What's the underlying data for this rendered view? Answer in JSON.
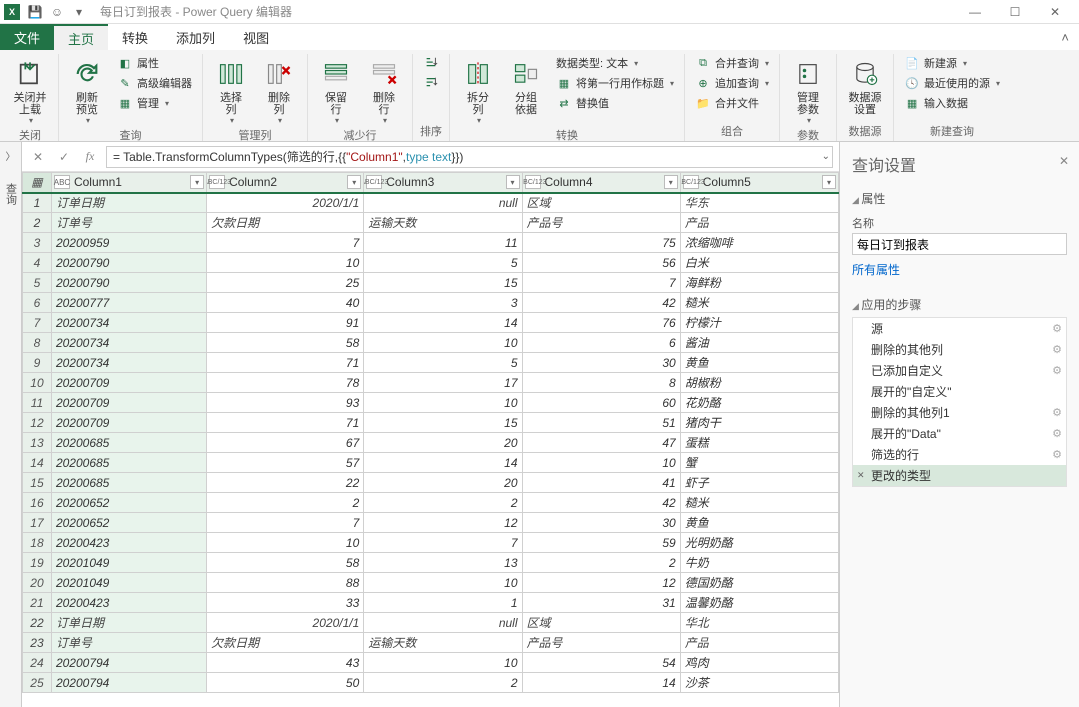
{
  "window": {
    "title": "每日订到报表 - Power Query 编辑器",
    "app_abbrev": "X"
  },
  "ribbon": {
    "tabs": {
      "file": "文件",
      "home": "主页",
      "transform": "转换",
      "addcol": "添加列",
      "view": "视图"
    },
    "close_upload": "关闭并\n上载",
    "refresh_preview": "刷新\n预览",
    "properties": "属性",
    "adv_editor": "高级编辑器",
    "manage": "管理",
    "choose_cols": "选择\n列",
    "remove_cols": "删除\n列",
    "keep_rows": "保留\n行",
    "remove_rows": "删除\n行",
    "sort_asc": "",
    "sort_desc": "",
    "split_col": "拆分\n列",
    "group_by": "分组\n依据",
    "datatype": "数据类型: 文本",
    "first_row_header": "将第一行用作标题",
    "replace_values": "替换值",
    "merge_q": "合并查询",
    "append_q": "追加查询",
    "merge_files": "合并文件",
    "manage_params": "管理\n参数",
    "datasource_settings": "数据源\n设置",
    "new_source": "新建源",
    "recent_sources": "最近使用的源",
    "enter_data": "输入数据",
    "groups": {
      "close": "关闭",
      "query": "查询",
      "manage_cols": "管理列",
      "reduce_rows": "减少行",
      "sort": "排序",
      "transform": "转换",
      "combine": "组合",
      "params": "参数",
      "datasources": "数据源",
      "new_query": "新建查询"
    }
  },
  "formula": "= Table.TransformColumnTypes(筛选的行,{{\"Column1\", type text}})",
  "formula_parts": {
    "p1": "= Table.TransformColumnTypes(筛选的行,{{",
    "p2": "\"Column1\"",
    "p3": ", ",
    "p4": "type text",
    "p5": "}})"
  },
  "left_label": "查询",
  "columns": [
    {
      "name": "Column1",
      "type": "ABC"
    },
    {
      "name": "Column2",
      "type": "ABC/123"
    },
    {
      "name": "Column3",
      "type": "ABC/123"
    },
    {
      "name": "Column4",
      "type": "ABC/123"
    },
    {
      "name": "Column5",
      "type": "ABC/123"
    }
  ],
  "rows": [
    {
      "n": 1,
      "c1": "订单日期",
      "c2": "2020/1/1",
      "c3": "null",
      "c4": "区域",
      "c5": "华东",
      "section": true
    },
    {
      "n": 2,
      "c1": "订单号",
      "c2": "欠款日期",
      "c3": "运输天数",
      "c4": "产品号",
      "c5": "产品",
      "section": true,
      "c2txt": true,
      "c3txt": true,
      "c4txt": true
    },
    {
      "n": 3,
      "c1": "20200959",
      "c2": "7",
      "c3": "11",
      "c4": "75",
      "c5": "浓缩咖啡"
    },
    {
      "n": 4,
      "c1": "20200790",
      "c2": "10",
      "c3": "5",
      "c4": "56",
      "c5": "白米"
    },
    {
      "n": 5,
      "c1": "20200790",
      "c2": "25",
      "c3": "15",
      "c4": "7",
      "c5": "海鲜粉"
    },
    {
      "n": 6,
      "c1": "20200777",
      "c2": "40",
      "c3": "3",
      "c4": "42",
      "c5": "糙米"
    },
    {
      "n": 7,
      "c1": "20200734",
      "c2": "91",
      "c3": "14",
      "c4": "76",
      "c5": "柠檬汁"
    },
    {
      "n": 8,
      "c1": "20200734",
      "c2": "58",
      "c3": "10",
      "c4": "6",
      "c5": "酱油"
    },
    {
      "n": 9,
      "c1": "20200734",
      "c2": "71",
      "c3": "5",
      "c4": "30",
      "c5": "黄鱼"
    },
    {
      "n": 10,
      "c1": "20200709",
      "c2": "78",
      "c3": "17",
      "c4": "8",
      "c5": "胡椒粉"
    },
    {
      "n": 11,
      "c1": "20200709",
      "c2": "93",
      "c3": "10",
      "c4": "60",
      "c5": "花奶酪"
    },
    {
      "n": 12,
      "c1": "20200709",
      "c2": "71",
      "c3": "15",
      "c4": "51",
      "c5": "猪肉干"
    },
    {
      "n": 13,
      "c1": "20200685",
      "c2": "67",
      "c3": "20",
      "c4": "47",
      "c5": "蛋糕"
    },
    {
      "n": 14,
      "c1": "20200685",
      "c2": "57",
      "c3": "14",
      "c4": "10",
      "c5": "蟹"
    },
    {
      "n": 15,
      "c1": "20200685",
      "c2": "22",
      "c3": "20",
      "c4": "41",
      "c5": "虾子"
    },
    {
      "n": 16,
      "c1": "20200652",
      "c2": "2",
      "c3": "2",
      "c4": "42",
      "c5": "糙米"
    },
    {
      "n": 17,
      "c1": "20200652",
      "c2": "7",
      "c3": "12",
      "c4": "30",
      "c5": "黄鱼"
    },
    {
      "n": 18,
      "c1": "20200423",
      "c2": "10",
      "c3": "7",
      "c4": "59",
      "c5": "光明奶酪"
    },
    {
      "n": 19,
      "c1": "20201049",
      "c2": "58",
      "c3": "13",
      "c4": "2",
      "c5": "牛奶"
    },
    {
      "n": 20,
      "c1": "20201049",
      "c2": "88",
      "c3": "10",
      "c4": "12",
      "c5": "德国奶酪"
    },
    {
      "n": 21,
      "c1": "20200423",
      "c2": "33",
      "c3": "1",
      "c4": "31",
      "c5": "温馨奶酪"
    },
    {
      "n": 22,
      "c1": "订单日期",
      "c2": "2020/1/1",
      "c3": "null",
      "c4": "区域",
      "c5": "华北",
      "section": true
    },
    {
      "n": 23,
      "c1": "订单号",
      "c2": "欠款日期",
      "c3": "运输天数",
      "c4": "产品号",
      "c5": "产品",
      "section": true,
      "c2txt": true,
      "c3txt": true,
      "c4txt": true
    },
    {
      "n": 24,
      "c1": "20200794",
      "c2": "43",
      "c3": "10",
      "c4": "54",
      "c5": "鸡肉"
    },
    {
      "n": 25,
      "c1": "20200794",
      "c2": "50",
      "c3": "2",
      "c4": "14",
      "c5": "沙茶"
    }
  ],
  "settings": {
    "title": "查询设置",
    "properties": "属性",
    "name_label": "名称",
    "name_value": "每日订到报表",
    "all_props": "所有属性",
    "applied_steps": "应用的步骤",
    "steps": [
      {
        "label": "源",
        "gear": true
      },
      {
        "label": "删除的其他列",
        "gear": true
      },
      {
        "label": "已添加自定义",
        "gear": true
      },
      {
        "label": "展开的\"自定义\"",
        "gear": false
      },
      {
        "label": "删除的其他列1",
        "gear": true
      },
      {
        "label": "展开的\"Data\"",
        "gear": true
      },
      {
        "label": "筛选的行",
        "gear": true
      },
      {
        "label": "更改的类型",
        "gear": false,
        "selected": true
      }
    ]
  }
}
